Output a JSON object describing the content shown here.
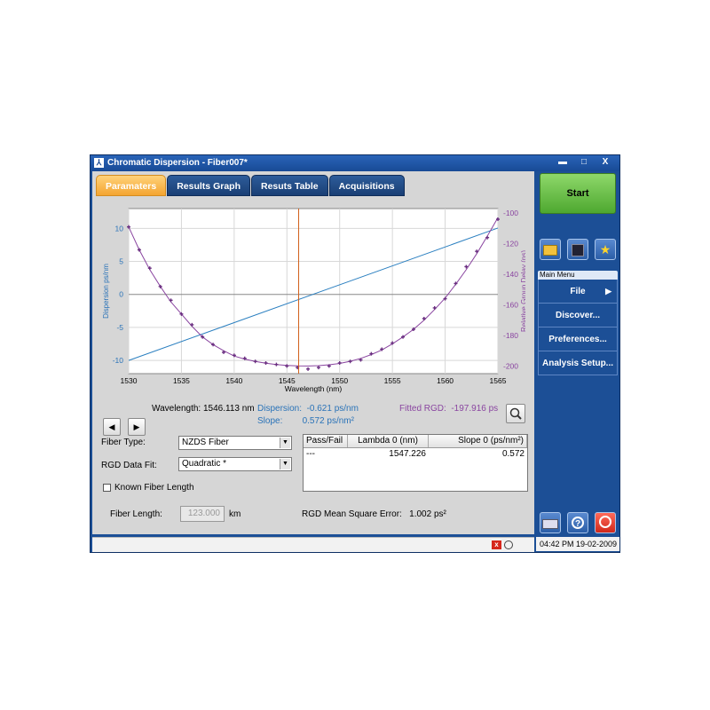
{
  "window": {
    "title": "Chromatic Dispersion - Fiber007*",
    "min": "▬",
    "max": "□",
    "close": "X"
  },
  "tabs": [
    "Paramaters",
    "Results Graph",
    "Resuts Table",
    "Acquisitions"
  ],
  "chart_data": {
    "type": "line",
    "xlabel": "Wavelength (nm)",
    "ylabel": "Dispersion ps/nm",
    "y2label": "Relative Group Delay (ps)",
    "xlim": [
      1530,
      1565
    ],
    "ylim": [
      -12,
      13
    ],
    "y2lim": [
      -205,
      -97
    ],
    "xticks": [
      1530,
      1535,
      1540,
      1545,
      1550,
      1555,
      1560,
      1565
    ],
    "yticks": [
      10,
      5,
      0,
      -5,
      -10
    ],
    "y2ticks": [
      -100,
      -120,
      -140,
      -160,
      -180,
      -200
    ],
    "grid": true,
    "cursor_x": 1546.113,
    "series": [
      {
        "x": [
          1530,
          1565
        ],
        "y": [
          -10,
          10.05
        ],
        "axis": "left",
        "color": "#2a7fc0"
      },
      {
        "x": [
          1530,
          1531,
          1532,
          1533,
          1534,
          1535,
          1536,
          1537,
          1538,
          1539,
          1540,
          1541,
          1542,
          1543,
          1544,
          1545,
          1546,
          1547,
          1548,
          1549,
          1550,
          1551,
          1552,
          1553,
          1554,
          1555,
          1556,
          1557,
          1558,
          1559,
          1560,
          1561,
          1562,
          1563,
          1564,
          1565
        ],
        "y": [
          -109,
          -124,
          -137,
          -148,
          -158,
          -166,
          -174,
          -181,
          -186,
          -190,
          -193.5,
          -195.5,
          -197,
          -198.2,
          -199,
          -199.6,
          -199.9,
          -200,
          -199.8,
          -199.2,
          -198.3,
          -196.9,
          -195,
          -192.5,
          -189.5,
          -185.5,
          -181,
          -176,
          -170,
          -163,
          -155.5,
          -146.5,
          -137,
          -126.5,
          -115,
          -103
        ],
        "axis": "right",
        "color": "#8a45a0",
        "role": "fit"
      },
      {
        "x": [
          1530,
          1531,
          1532,
          1533,
          1534,
          1535,
          1536,
          1537,
          1538,
          1539,
          1540,
          1541,
          1542,
          1543,
          1544,
          1545,
          1546,
          1547,
          1548,
          1549,
          1550,
          1551,
          1552,
          1553,
          1554,
          1555,
          1556,
          1557,
          1558,
          1559,
          1560,
          1561,
          1562,
          1563,
          1564,
          1565
        ],
        "y": [
          -109,
          -124,
          -136,
          -148,
          -157,
          -166,
          -173,
          -181,
          -186,
          -191,
          -193,
          -195,
          -197,
          -198,
          -199,
          -200,
          -201,
          -202,
          -201,
          -200,
          -198,
          -197,
          -196,
          -192,
          -189,
          -185,
          -181,
          -176,
          -169,
          -162,
          -156,
          -146,
          -135,
          -125,
          -116,
          -104
        ],
        "axis": "right",
        "color": "#8a45a0",
        "role": "points"
      }
    ]
  },
  "nav": {
    "prev": "◀",
    "next": "▶"
  },
  "readout": {
    "wavelength": "Wavelength: 1546.113 nm",
    "dispersion": "Dispersion:  -0.621 ps/nm",
    "slope": "Slope:        0.572 ps/nm²",
    "fitted_rgd": "Fitted RGD:  -197.916 ps"
  },
  "form": {
    "fiber_type_label": "Fiber Type:",
    "fiber_type_value": "NZDS Fiber",
    "rgd_fit_label": "RGD Data Fit:",
    "rgd_fit_value": "Quadratic *",
    "known_length_label": "Known Fiber Length",
    "fiber_length_label": "Fiber Length:",
    "fiber_length_value": "123.000",
    "fiber_length_unit": "km",
    "mse": "RGD Mean Square Error:   1.002 ps²"
  },
  "table": {
    "headers": [
      "Pass/Fail",
      "Lambda 0 (nm)",
      "Slope 0 (ps/nm²)"
    ],
    "rows": [
      [
        "---",
        "1547.226",
        "0.572"
      ]
    ]
  },
  "sidebar": {
    "start": "Start",
    "menu_header": "Main Menu",
    "items": [
      {
        "label": "File",
        "arrow": "▶"
      },
      {
        "label": "Discover..."
      },
      {
        "label": "Preferences..."
      },
      {
        "label": "Analysis Setup..."
      }
    ]
  },
  "status": {
    "clock": "04:42 PM 19-02-2009"
  }
}
